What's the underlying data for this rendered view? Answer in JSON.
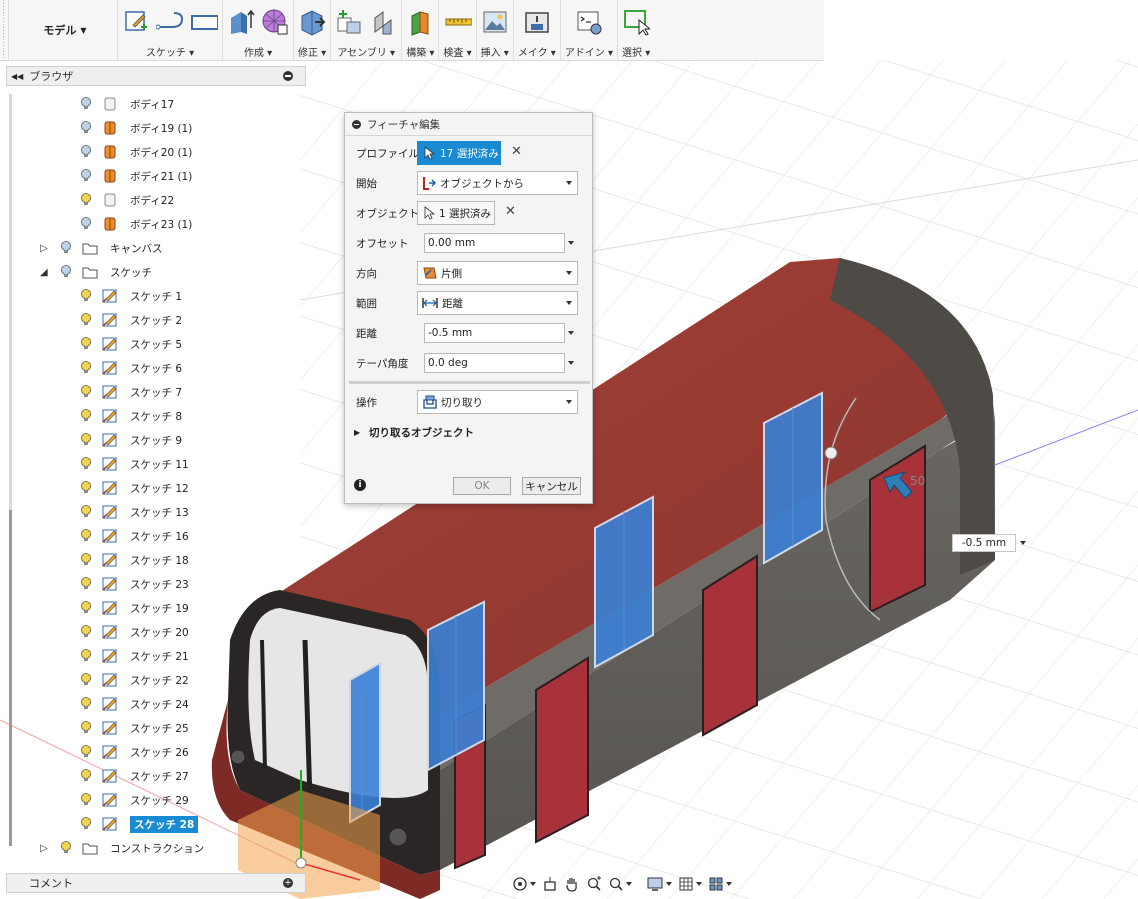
{
  "toolbar": {
    "workspace": "モデル",
    "groups": [
      {
        "label": "スケッチ ▾",
        "icons": [
          "sketch-create-icon",
          "arc-icon",
          "rectangle-icon"
        ]
      },
      {
        "label": "作成 ▾",
        "icons": [
          "extrude-icon",
          "form-icon"
        ]
      },
      {
        "label": "修正 ▾",
        "icons": [
          "press-pull-icon"
        ]
      },
      {
        "label": "アセンブリ ▾",
        "icons": [
          "new-component-icon",
          "joint-icon"
        ]
      },
      {
        "label": "構築 ▾",
        "icons": [
          "plane-icon"
        ]
      },
      {
        "label": "検査 ▾",
        "icons": [
          "measure-icon"
        ]
      },
      {
        "label": "挿入 ▾",
        "icons": [
          "insert-image-icon"
        ]
      },
      {
        "label": "メイク ▾",
        "icons": [
          "3d-print-icon"
        ]
      },
      {
        "label": "アドイン ▾",
        "icons": [
          "scripts-icon"
        ]
      },
      {
        "label": "選択 ▾",
        "icons": [
          "select-icon"
        ]
      }
    ]
  },
  "browser": {
    "title": "ブラウザ",
    "items": [
      {
        "label": "ボディ17",
        "kind": "body-white"
      },
      {
        "label": "ボディ19 (1)",
        "kind": "body-orange"
      },
      {
        "label": "ボディ20 (1)",
        "kind": "body-orange"
      },
      {
        "label": "ボディ21 (1)",
        "kind": "body-orange"
      },
      {
        "label": "ボディ22",
        "kind": "body-white"
      },
      {
        "label": "ボディ23 (1)",
        "kind": "body-orange"
      },
      {
        "label": "キャンバス",
        "kind": "folder"
      },
      {
        "label": "スケッチ",
        "kind": "folder"
      },
      {
        "label": "スケッチ 1",
        "kind": "sketch"
      },
      {
        "label": "スケッチ 2",
        "kind": "sketch"
      },
      {
        "label": "スケッチ 5",
        "kind": "sketch"
      },
      {
        "label": "スケッチ 6",
        "kind": "sketch"
      },
      {
        "label": "スケッチ 7",
        "kind": "sketch"
      },
      {
        "label": "スケッチ 8",
        "kind": "sketch"
      },
      {
        "label": "スケッチ 9",
        "kind": "sketch"
      },
      {
        "label": "スケッチ 11",
        "kind": "sketch"
      },
      {
        "label": "スケッチ 12",
        "kind": "sketch"
      },
      {
        "label": "スケッチ 13",
        "kind": "sketch"
      },
      {
        "label": "スケッチ 16",
        "kind": "sketch"
      },
      {
        "label": "スケッチ 18",
        "kind": "sketch"
      },
      {
        "label": "スケッチ 23",
        "kind": "sketch"
      },
      {
        "label": "スケッチ 19",
        "kind": "sketch"
      },
      {
        "label": "スケッチ 20",
        "kind": "sketch"
      },
      {
        "label": "スケッチ 21",
        "kind": "sketch"
      },
      {
        "label": "スケッチ 22",
        "kind": "sketch"
      },
      {
        "label": "スケッチ 24",
        "kind": "sketch"
      },
      {
        "label": "スケッチ 25",
        "kind": "sketch"
      },
      {
        "label": "スケッチ 26",
        "kind": "sketch"
      },
      {
        "label": "スケッチ 27",
        "kind": "sketch"
      },
      {
        "label": "スケッチ 29",
        "kind": "sketch"
      },
      {
        "label": "スケッチ 28",
        "kind": "sketch",
        "selected": true
      },
      {
        "label": "コンストラクション",
        "kind": "folder"
      }
    ]
  },
  "comments": {
    "title": "コメント"
  },
  "dialog": {
    "title": "フィーチャ編集",
    "profile": {
      "label": "プロファイル",
      "value": "17 選択済み"
    },
    "start": {
      "label": "開始",
      "value": "オブジェクトから"
    },
    "object": {
      "label": "オブジェクト",
      "value": "1 選択済み"
    },
    "offset": {
      "label": "オフセット",
      "value": "0.00 mm"
    },
    "direction": {
      "label": "方向",
      "value": "片側"
    },
    "extent": {
      "label": "範囲",
      "value": "距離"
    },
    "distance": {
      "label": "距離",
      "value": "-0.5 mm"
    },
    "taper": {
      "label": "テーパ角度",
      "value": "0.0 deg"
    },
    "operation": {
      "label": "操作",
      "value": "切り取り"
    },
    "cut_objects": "切り取るオブジェクト",
    "ok": "OK",
    "cancel": "キャンセル"
  },
  "viewport": {
    "dimension_value": "-0.5 mm",
    "manipulator_label": "50"
  },
  "colors": {
    "accent": "#1a8ad3",
    "train_red": "#9b3b33",
    "train_gray": "#5e5c58",
    "window_blue": "#3a7fd6",
    "door_red": "#a8323a"
  }
}
